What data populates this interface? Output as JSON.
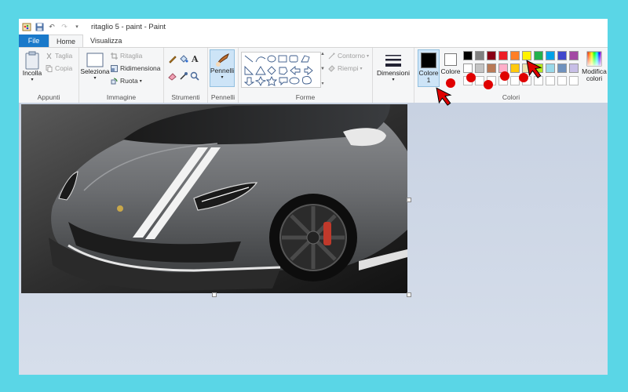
{
  "window": {
    "title": "ritaglio 5 - paint - Paint"
  },
  "tabs": {
    "file": "File",
    "home": "Home",
    "view": "Visualizza"
  },
  "groups": {
    "clipboard": {
      "label": "Appunti",
      "paste": "Incolla",
      "cut": "Taglia",
      "copy": "Copia"
    },
    "image": {
      "label": "Immagine",
      "select": "Seleziona",
      "crop": "Ritaglia",
      "resize": "Ridimensiona",
      "rotate": "Ruota"
    },
    "tools": {
      "label": "Strumenti"
    },
    "brushes": {
      "label": "Pennelli"
    },
    "shapes": {
      "label": "Forme",
      "outline": "Contorno",
      "fill": "Riempi"
    },
    "size": {
      "label": "Dimensioni"
    },
    "colors": {
      "label": "Colori",
      "color1_line1": "Colore",
      "color1_line2": "1",
      "color2": "Colore",
      "edit_line1": "Modifica",
      "edit_line2": "colori"
    }
  },
  "palette": {
    "row1": [
      "#000000",
      "#7f7f7f",
      "#880015",
      "#ed1c24",
      "#ff7f27",
      "#fff200",
      "#22b14c",
      "#00a2e8",
      "#3f48cc",
      "#a349a4"
    ],
    "row2": [
      "#ffffff",
      "#c3c3c3",
      "#b97a57",
      "#ffaec9",
      "#ffc90e",
      "#efe4b0",
      "#b5e61d",
      "#99d9ea",
      "#7092be",
      "#c8bfe7"
    ]
  },
  "primary_color": "#000000",
  "secondary_color": "#ffffff",
  "annotation_color": "#e00000"
}
